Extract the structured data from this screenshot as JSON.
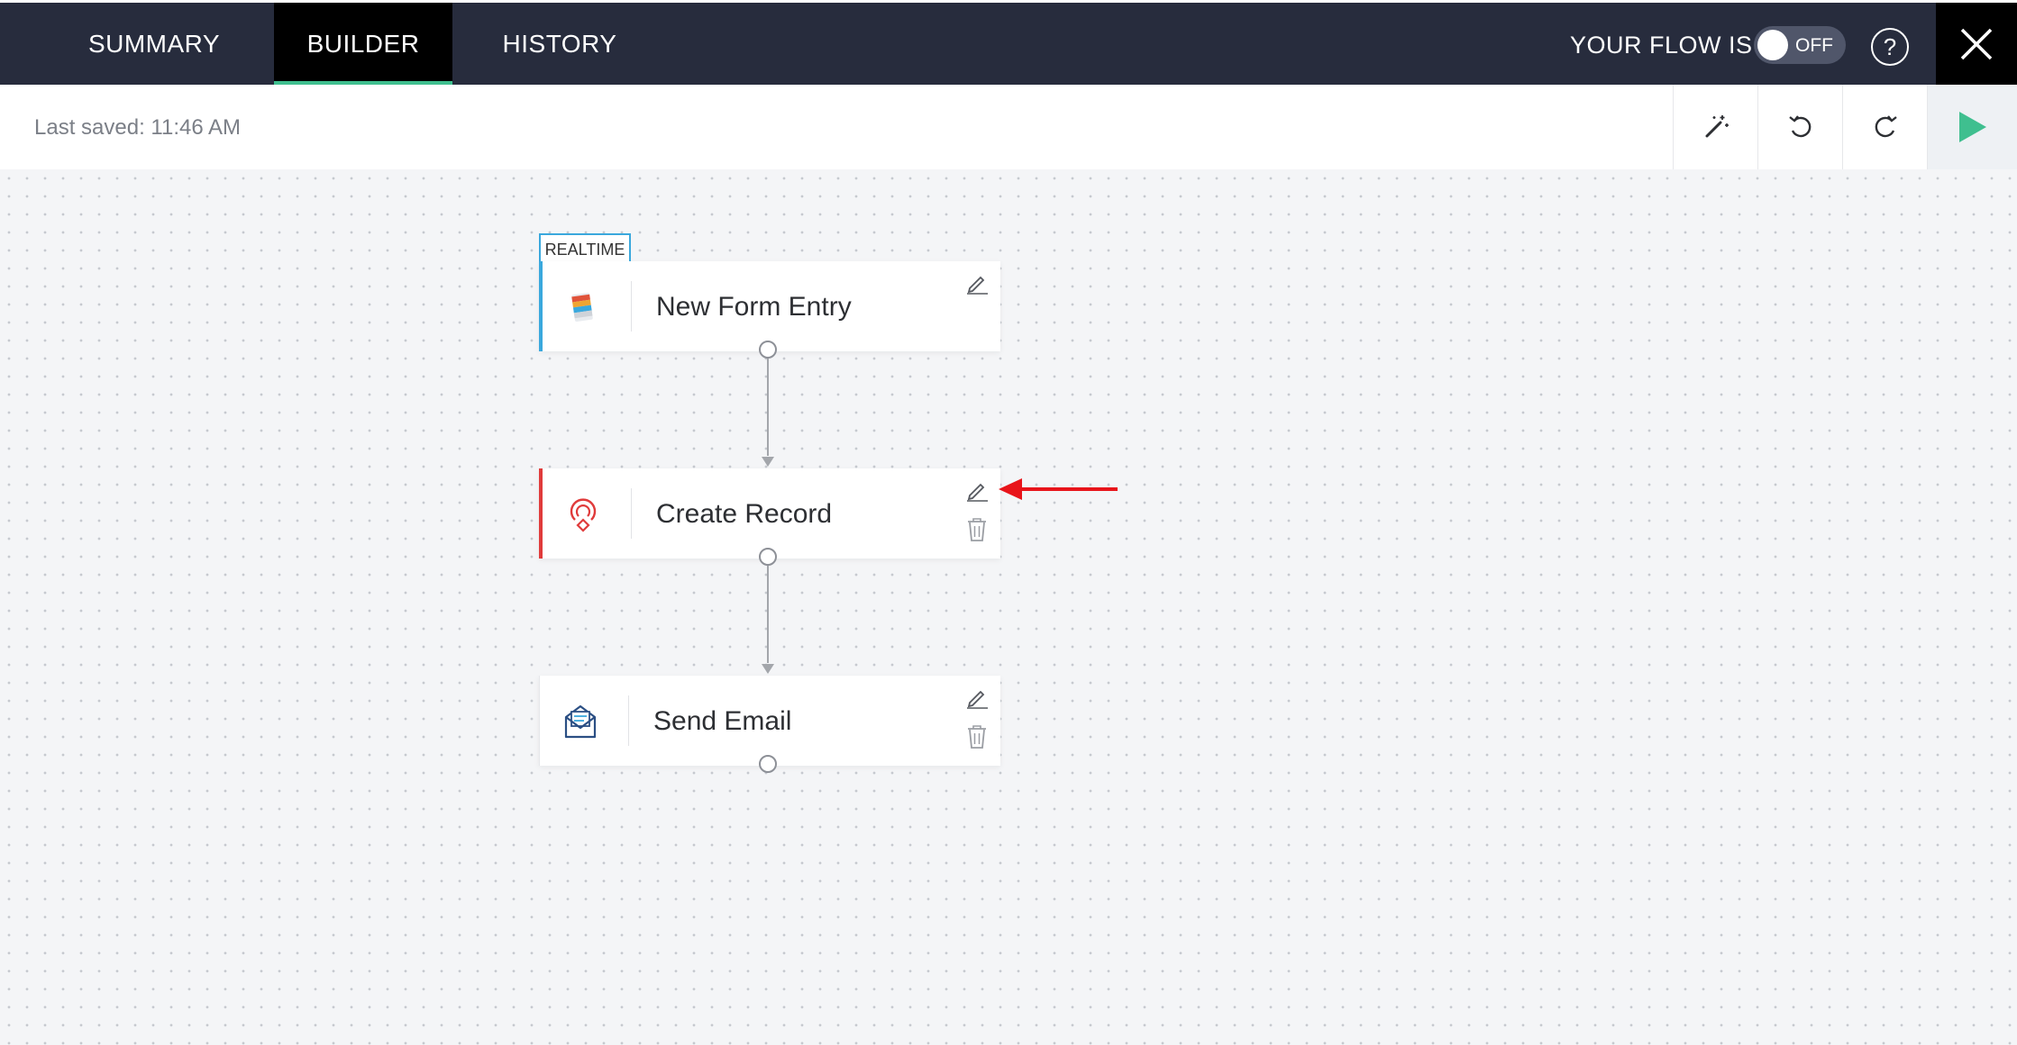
{
  "nav": {
    "tabs": [
      {
        "label": "SUMMARY"
      },
      {
        "label": "BUILDER",
        "active": true
      },
      {
        "label": "HISTORY"
      }
    ],
    "flow_status_label": "YOUR FLOW IS",
    "toggle_text": "OFF",
    "help_label": "?"
  },
  "toolbar": {
    "last_saved": "Last saved: 11:46 AM",
    "tools": [
      "magic-wand-icon",
      "undo-icon",
      "redo-icon",
      "play-icon"
    ]
  },
  "flow": {
    "trigger_tag": "REALTIME",
    "nodes": [
      {
        "label": "New Form Entry",
        "icon": "form-app-icon",
        "accent": "#3aa8dd"
      },
      {
        "label": "Create Record",
        "icon": "create-record-icon",
        "accent": "#e03b3b"
      },
      {
        "label": "Send Email",
        "icon": "email-icon",
        "accent": "#2b4f84"
      }
    ]
  },
  "colors": {
    "nav_bg": "#272c3d",
    "active_tab_bg": "#000000",
    "active_tab_underline": "#3fbf8f",
    "run_button": "#3fbf8f",
    "annotation_arrow": "#e8141a"
  }
}
